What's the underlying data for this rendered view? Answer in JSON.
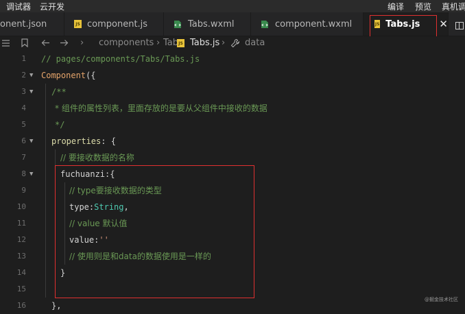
{
  "menubar": {
    "left": [
      "调试器",
      "云开发"
    ],
    "right": [
      "编译",
      "预览",
      "真机调"
    ]
  },
  "tabs": [
    {
      "label": "onent.json",
      "icon": "json-icon",
      "active": false
    },
    {
      "label": "component.js",
      "icon": "js-file-icon",
      "active": false
    },
    {
      "label": "Tabs.wxml",
      "icon": "wxml-file-icon",
      "active": false
    },
    {
      "label": "component.wxml",
      "icon": "wxml-file-icon",
      "active": false
    },
    {
      "label": "Tabs.js",
      "icon": "js-file-icon",
      "active": true
    }
  ],
  "tab_close": "✕",
  "breadcrumb": [
    "components",
    "Tabs",
    "Tabs.js",
    "data"
  ],
  "code": {
    "line_numbers": [
      "1",
      "2",
      "3",
      "4",
      "5",
      "6",
      "7",
      "8",
      "9",
      "10",
      "11",
      "12",
      "13",
      "14",
      "15",
      "16"
    ],
    "l1": "// pages/components/Tabs/Tabs.js",
    "l2_fn": "Component",
    "l2_rest": "({",
    "l3": "/**",
    "l4": "* 组件的属性列表，里面存放的是要从父组件中接收的数据",
    "l5": "*/",
    "l6_key": "properties",
    "l6_rest": ": {",
    "l7": "// 要接收数据的名称",
    "l8_key": "fuchuanzi",
    "l8_rest": ":{",
    "l9": "// type要接收数据的类型",
    "l10_key": "type",
    "l10_colon": ":",
    "l10_val": "String",
    "l10_comma": ",",
    "l11": "// value 默认值",
    "l12_key": "value",
    "l12_colon": ":",
    "l12_val": "''",
    "l13": "// 使用则是和data的数据使用是一样的",
    "l14": "}",
    "l16": "},"
  },
  "watermark": "@掘金技术社区",
  "colors": {
    "highlight": "#e03030",
    "comment": "#6a9955",
    "keyword": "#e5a46a",
    "type": "#4ec9b0"
  }
}
